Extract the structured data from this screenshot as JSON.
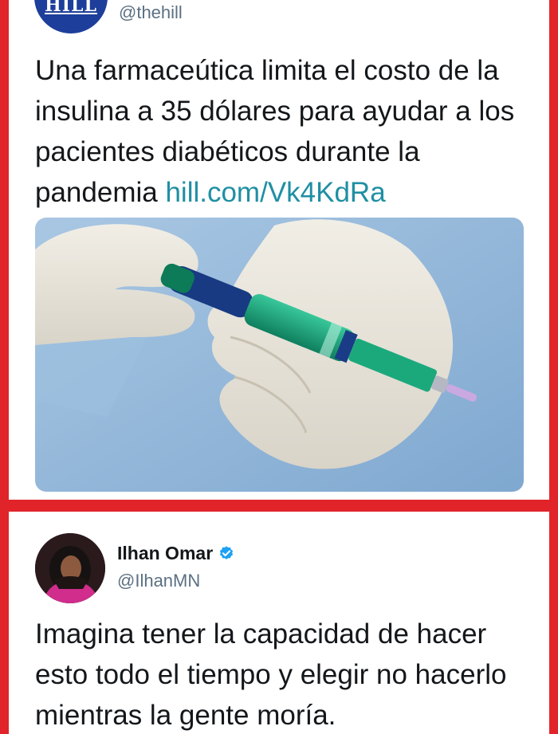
{
  "tweets": [
    {
      "avatar_text": "HILL",
      "handle": "@thehill",
      "text": "Una farmaceútica limita el costo de la insulina a 35 dólares para ayudar a los pacientes diabéticos durante la pandemia ",
      "link": "hill.com/Vk4KdRa",
      "media_icon": "insulin-pen-photo"
    },
    {
      "display_name": "Ilhan Omar",
      "verified_icon": "verified-badge-icon",
      "handle": "@IlhanMN",
      "text": "Imagina tener la capacidad de hacer esto todo el tiempo y elegir no hacerlo mientras la gente moría."
    }
  ],
  "colors": {
    "border_red": "#e0242a",
    "link": "#1f8fa3",
    "text": "#14171a",
    "secondary_text": "#5b7083",
    "verified": "#1da1f2",
    "hill_blue": "#1d3e9a"
  }
}
